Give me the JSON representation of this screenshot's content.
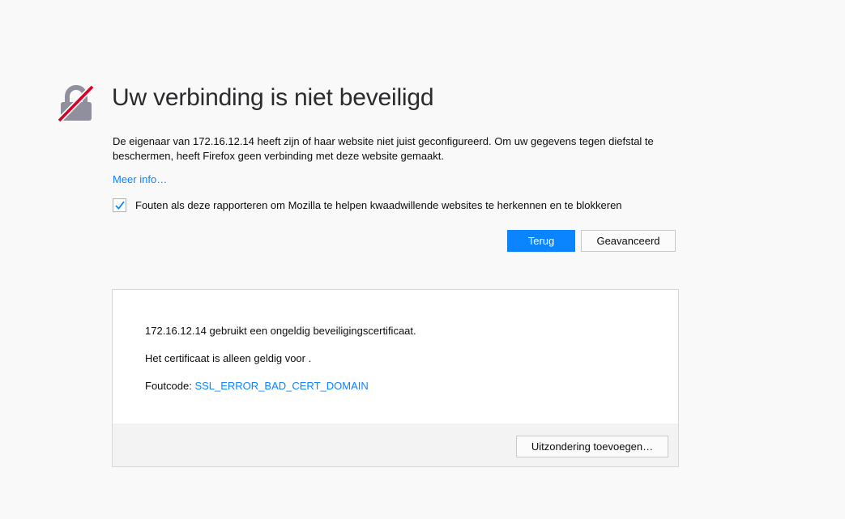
{
  "page": {
    "title": "Uw verbinding is niet beveiligd",
    "description": "De eigenaar van 172.16.12.14 heeft zijn of haar website niet juist geconfigureerd. Om uw gegevens tegen diefstal te beschermen, heeft Firefox geen verbinding met deze website gemaakt.",
    "more_info_link": "Meer info…",
    "report_checkbox": {
      "label": "Fouten als deze rapporteren om Mozilla te helpen kwaadwillende websites te herkennen en te blokkeren",
      "checked": true
    },
    "icon": "broken-lock-icon"
  },
  "buttons": {
    "back": "Terug",
    "advanced": "Geavanceerd"
  },
  "advanced": {
    "line1": "172.16.12.14 gebruikt een ongeldig beveiligingscertificaat.",
    "line2": "Het certificaat is alleen geldig voor .",
    "error_code_label": "Foutcode: ",
    "error_code": "SSL_ERROR_BAD_CERT_DOMAIN",
    "add_exception_button": "Uitzondering toevoegen…"
  },
  "colors": {
    "accent": "#0a84ff",
    "lock_gray": "#8f8f9d",
    "slash_red": "#d70022",
    "background": "#f9f9fa"
  }
}
